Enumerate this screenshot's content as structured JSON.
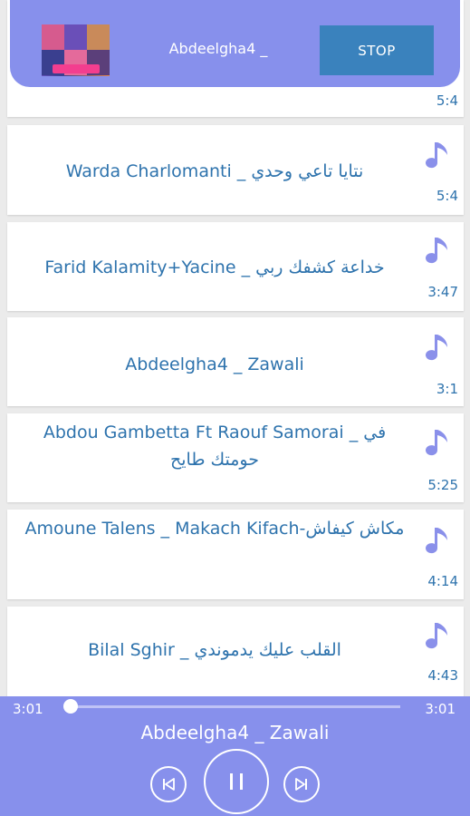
{
  "now_playing_header": {
    "title": "Abdeelgha4 _",
    "stop_label": "STOP"
  },
  "songs": [
    {
      "title": "",
      "duration": "5:4"
    },
    {
      "title": "Warda Charlomanti _ نتايا تاعي وحدي",
      "duration": "5:4"
    },
    {
      "title": "Farid Kalamity+Yacine _ خداعة كشفك ربي",
      "duration": "3:47"
    },
    {
      "title": "Abdeelgha4 _ Zawali",
      "duration": "3:1"
    },
    {
      "title": "Abdou Gambetta Ft Raouf Samorai _ في حومتك طايح",
      "duration": "5:25"
    },
    {
      "title": "Amoune Talens _ Makach Kifach-مكاش كيفاش",
      "duration": "4:14"
    },
    {
      "title": "Bilal Sghir _ القلب عليك يدموندي",
      "duration": "4:43"
    }
  ],
  "player": {
    "current_time": "3:01",
    "total_time": "3:01",
    "progress": 0.0,
    "title": "Abdeelgha4 _ Zawali"
  },
  "colors": {
    "accent": "#8790ec",
    "stop_button": "#3a82bd",
    "text_blue": "#2e73ad",
    "note_icon": "#8a90ea"
  },
  "icons": {
    "note": "music-note-icon",
    "prev": "skip-previous-icon",
    "pause": "pause-icon",
    "next": "skip-next-icon"
  }
}
